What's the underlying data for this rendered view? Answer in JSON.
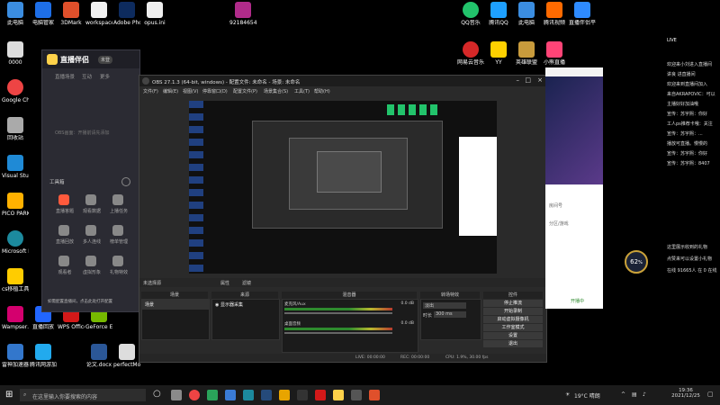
{
  "desktop_icons": [
    {
      "label": "此电脑",
      "color": "#3b8de0"
    },
    {
      "label": "电脑管家",
      "color": "#1e6fe8"
    },
    {
      "label": "3DMark",
      "color": "#e0502b"
    },
    {
      "label": "workspace…",
      "color": "#f1f1f1"
    },
    {
      "label": "Adobe Photosho…",
      "color": "#0d2b5e"
    },
    {
      "label": "opus.ini",
      "color": "#eeeeee"
    },
    {
      "label": "0000",
      "color": "#dddddd"
    },
    {
      "label": "Google Chrome",
      "color": "#e44"
    },
    {
      "label": "回收站",
      "color": "#aaaaaa"
    },
    {
      "label": "Visual Studio Code",
      "color": "#1f8ad6"
    },
    {
      "label": "PICO PARK",
      "color": "#ffb100"
    },
    {
      "label": "Microsoft Edge",
      "color": "#1c8a9e"
    },
    {
      "label": "cs移植工具",
      "color": "#ffcc00"
    },
    {
      "label": "Wampser…",
      "color": "#d4006e"
    },
    {
      "label": "直播回放",
      "color": "#2266ff"
    },
    {
      "label": "雷神加速器",
      "color": "#3377cc"
    },
    {
      "label": "腾讯网游加速器",
      "color": "#22aaee"
    },
    {
      "label": "WPS Office",
      "color": "#d31919"
    },
    {
      "label": "GeForce Experience",
      "color": "#76b900"
    },
    {
      "label": "论文.docx",
      "color": "#2b5797"
    },
    {
      "label": "perfectMo…",
      "color": "#dddddd"
    },
    {
      "label": "92184654…",
      "color": "#b02b8a"
    },
    {
      "label": "QQ音乐",
      "color": "#22c36b"
    },
    {
      "label": "腾讯QQ",
      "color": "#1ea0ff"
    },
    {
      "label": "此电脑",
      "color": "#3b8de0"
    },
    {
      "label": "腾讯视频",
      "color": "#ff6a00"
    },
    {
      "label": "网易云音乐",
      "color": "#d62828"
    },
    {
      "label": "YY",
      "color": "#ffd100"
    },
    {
      "label": "英雄联盟",
      "color": "#c89b3c"
    },
    {
      "label": "小熊直播",
      "color": "#ff4477"
    },
    {
      "label": "直播伴侣平台",
      "color": "#2e8bff"
    }
  ],
  "assistant": {
    "logo_text": "直播伴侣",
    "badge": "未登",
    "tabs": [
      "直播场景",
      "互动",
      "更多"
    ],
    "placeholder": "OBS画面：开播前请先添加",
    "tools_title": "工具箱",
    "tools": [
      {
        "label": "直播答题",
        "color": "#ff5a3c"
      },
      {
        "label": "观看数据",
        "color": "#888"
      },
      {
        "label": "上播任务",
        "color": "#888"
      },
      {
        "label": "直播回放",
        "color": "#888"
      },
      {
        "label": "多人连线",
        "color": "#888"
      },
      {
        "label": "榜单管理",
        "color": "#888"
      },
      {
        "label": "观看者",
        "color": "#888"
      },
      {
        "label": "虚拟形象",
        "color": "#888"
      },
      {
        "label": "礼物特效",
        "color": "#888"
      }
    ],
    "notice": "如需配置直播间，点击此处打开配置"
  },
  "obs": {
    "title": "OBS 27.1.3 (64-bit, windows) - 配置文件: 未命名 - 场景: 未命名",
    "menu": [
      "文件(F)",
      "编辑(E)",
      "视图(V)",
      "停靠窗口(D)",
      "配置文件(P)",
      "场景集合(S)",
      "工具(T)",
      "帮助(H)"
    ],
    "source_bar": "未选择源",
    "source_props": "属性",
    "source_filter": "滤镜",
    "docks": {
      "scenes": "场景",
      "sources": "来源",
      "mixer": "混音器",
      "transitions": "转场特效",
      "controls": "控件"
    },
    "scene_item": "场景",
    "source_item": "显示器采集",
    "mixer_tracks": [
      {
        "name": "麦克风/Aux",
        "level": "0.0 dB"
      },
      {
        "name": "桌面音频",
        "level": "0.0 dB"
      }
    ],
    "transition_value": "淡出",
    "duration_label": "时长",
    "duration_value": "300 ms",
    "controls": [
      "停止推流",
      "开始录制",
      "启动虚拟摄像机",
      "工作室模式",
      "设置",
      "退出"
    ],
    "status": {
      "live": "LIVE: 00:00:00",
      "rec": "REC: 00:00:00",
      "cpu": "CPU: 1.9%, 30.00 fps"
    }
  },
  "browser": {
    "lines": [
      "房间号",
      "分区/游戏",
      "开播中"
    ]
  },
  "chat": {
    "header": "LIVE",
    "lines": [
      "欢迎来小刘进入直播间",
      "讲良 进直播间",
      "欢迎来到直播间加入",
      "来自AKRAPOVIC：可以",
      "主播好好加油哦",
      "宣传：苏宇熙：你好",
      "工人ps推荐卡哦：关注",
      "宣传：苏宇熙：...",
      "播放可直播。慢慢的",
      "宣传：苏宇熙：你好",
      "宣传：苏宇熙：8407",
      "这里展示收到的礼物",
      "点赞来可以设置小礼物",
      "在线 91665人 在 0 在线"
    ],
    "gauge": "62",
    "gauge_unit": "%"
  },
  "taskbar": {
    "search_placeholder": "在这里输入你要搜索的内容",
    "weather": "19°C 晴朗",
    "time": "19:36",
    "date": "2021/12/25"
  }
}
